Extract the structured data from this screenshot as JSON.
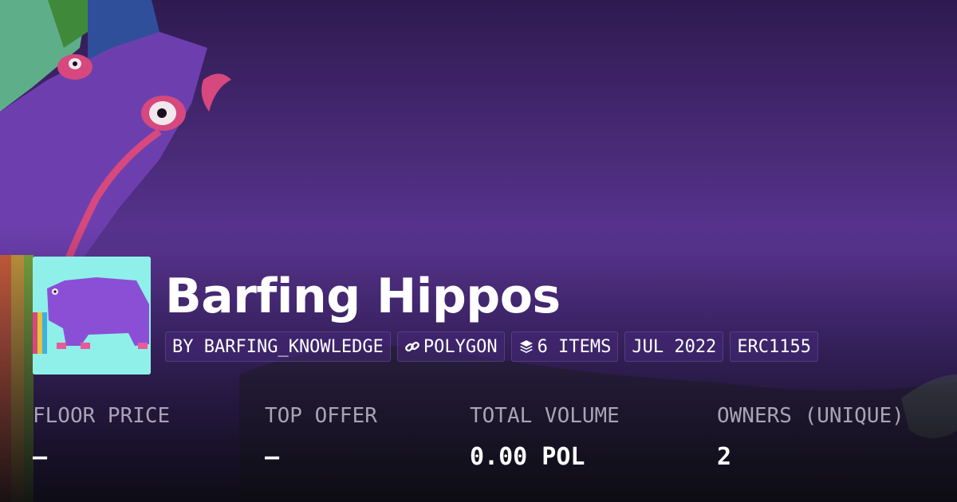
{
  "collection": {
    "title": "Barfing Hippos",
    "creator_tag": "BY BARFING_KNOWLEDGE",
    "chain_tag": "POLYGON",
    "chain_icon": "chain-link-icon",
    "items_tag": "6 ITEMS",
    "items_icon": "layers-icon",
    "date_tag": "JUL 2022",
    "standard_tag": "ERC1155"
  },
  "stats": [
    {
      "label": "FLOOR PRICE",
      "value": "–"
    },
    {
      "label": "TOP OFFER",
      "value": "–"
    },
    {
      "label": "TOTAL VOLUME",
      "value": "0.00 POL"
    },
    {
      "label": "OWNERS (UNIQUE)",
      "value": "2"
    }
  ],
  "colors": {
    "background_purple": "#5b3590",
    "thumbnail_bg": "#8ff0ea",
    "hippo_purple": "#8b4fd6",
    "text_white": "#ffffff",
    "label_gray": "#a9a3b6"
  }
}
